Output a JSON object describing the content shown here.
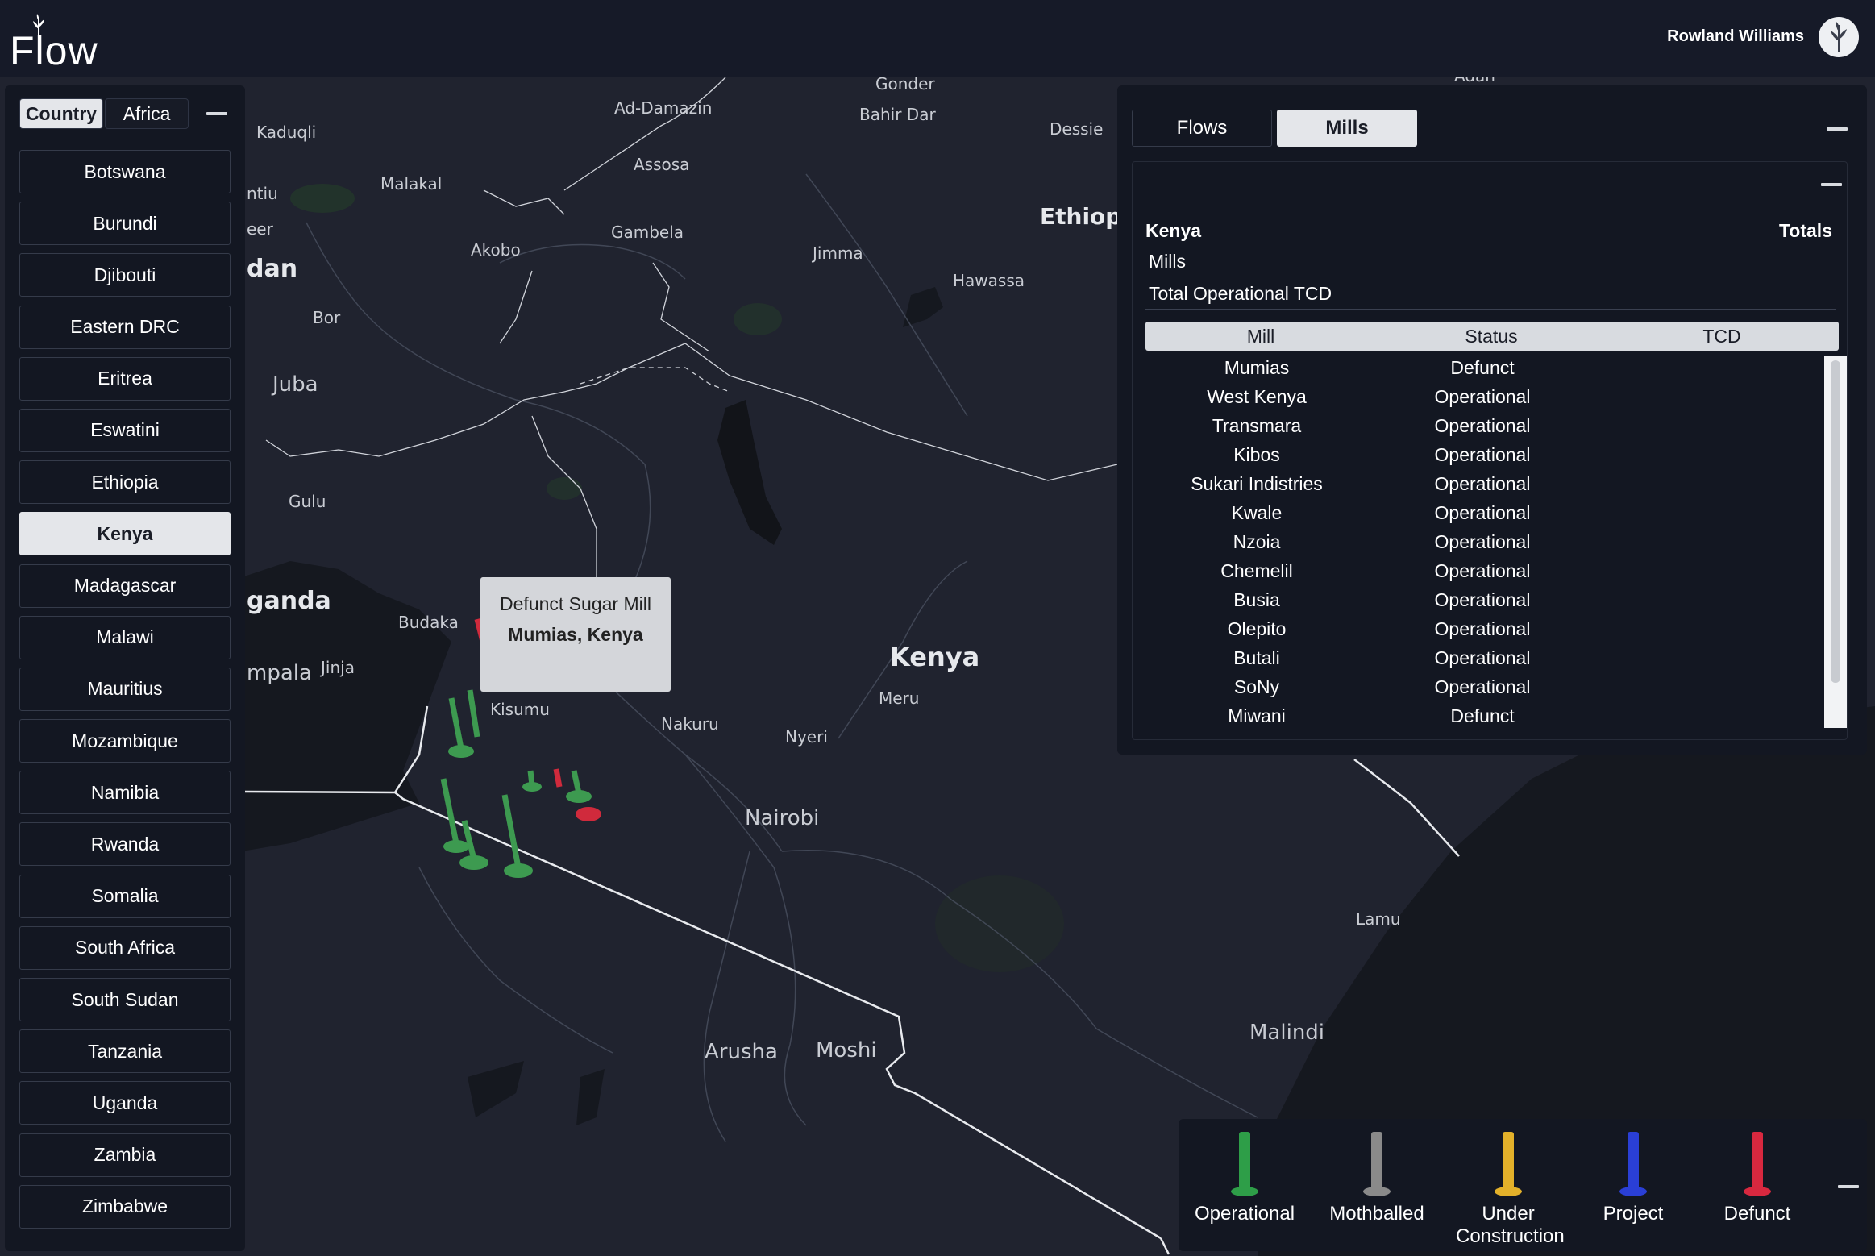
{
  "header": {
    "logo_text": "Flow",
    "user_name": "Rowland Williams"
  },
  "left_panel": {
    "segments": [
      "Country",
      "Africa"
    ],
    "countries": [
      "Botswana",
      "Burundi",
      "Djibouti",
      "Eastern DRC",
      "Eritrea",
      "Eswatini",
      "Ethiopia",
      "Kenya",
      "Madagascar",
      "Malawi",
      "Mauritius",
      "Mozambique",
      "Namibia",
      "Rwanda",
      "Somalia",
      "South Africa",
      "South Sudan",
      "Tanzania",
      "Uganda",
      "Zambia",
      "Zimbabwe"
    ],
    "selected_country": "Kenya"
  },
  "right_panel": {
    "tabs": [
      "Flows",
      "Mills"
    ],
    "active_tab": "Mills",
    "region": "Kenya",
    "totals_label": "Totals",
    "stats": [
      {
        "label": "Mills",
        "value": ""
      },
      {
        "label": "Total Operational TCD",
        "value": ""
      }
    ],
    "table": {
      "columns": [
        "Mill",
        "Status",
        "TCD"
      ],
      "rows": [
        {
          "mill": "Mumias",
          "status": "Defunct",
          "tcd": ""
        },
        {
          "mill": "West Kenya",
          "status": "Operational",
          "tcd": ""
        },
        {
          "mill": "Transmara",
          "status": "Operational",
          "tcd": ""
        },
        {
          "mill": "Kibos",
          "status": "Operational",
          "tcd": ""
        },
        {
          "mill": "Sukari Indistries",
          "status": "Operational",
          "tcd": ""
        },
        {
          "mill": "Kwale",
          "status": "Operational",
          "tcd": ""
        },
        {
          "mill": "Nzoia",
          "status": "Operational",
          "tcd": ""
        },
        {
          "mill": "Chemelil",
          "status": "Operational",
          "tcd": ""
        },
        {
          "mill": "Busia",
          "status": "Operational",
          "tcd": ""
        },
        {
          "mill": "Olepito",
          "status": "Operational",
          "tcd": ""
        },
        {
          "mill": "Butali",
          "status": "Operational",
          "tcd": ""
        },
        {
          "mill": "SoNy",
          "status": "Operational",
          "tcd": ""
        },
        {
          "mill": "Miwani",
          "status": "Defunct",
          "tcd": ""
        }
      ]
    }
  },
  "tooltip": {
    "line1": "Defunct Sugar Mill",
    "line2": "Mumias, Kenya"
  },
  "legend": [
    {
      "label": "Operational",
      "color": "#2e9e48"
    },
    {
      "label": "Mothballed",
      "color": "#8a8a8a"
    },
    {
      "label": "Under Construction",
      "color": "#e3b12a"
    },
    {
      "label": "Project",
      "color": "#2a3fd6"
    },
    {
      "label": "Defunct",
      "color": "#d8283f"
    }
  ],
  "map_labels": [
    {
      "text": "Gonder",
      "size": "s"
    },
    {
      "text": "Bahir Dar",
      "size": "s"
    },
    {
      "text": "Ad-Damazin",
      "size": "s"
    },
    {
      "text": "Dessie",
      "size": "s"
    },
    {
      "text": "Kaduqli",
      "size": "s"
    },
    {
      "text": "Assosa",
      "size": "s"
    },
    {
      "text": "Malakal",
      "size": "s"
    },
    {
      "text": "ntiu",
      "size": "s"
    },
    {
      "text": "Gambela",
      "size": "s"
    },
    {
      "text": "Ethiopi",
      "size": "l"
    },
    {
      "text": "eer",
      "size": "s"
    },
    {
      "text": "Akobo",
      "size": "s"
    },
    {
      "text": "Jimma",
      "size": "s"
    },
    {
      "text": "dan",
      "size": "l"
    },
    {
      "text": "Hawassa",
      "size": "s"
    },
    {
      "text": "Bor",
      "size": "s"
    },
    {
      "text": "Juba",
      "size": "m"
    },
    {
      "text": "Gulu",
      "size": "s"
    },
    {
      "text": "ganda",
      "size": "l"
    },
    {
      "text": "Budaka",
      "size": "s"
    },
    {
      "text": "Kenya",
      "size": "l"
    },
    {
      "text": "mpala",
      "size": "m"
    },
    {
      "text": "Jinja",
      "size": "s"
    },
    {
      "text": "Meru",
      "size": "s"
    },
    {
      "text": "Kisumu",
      "size": "s"
    },
    {
      "text": "Nakuru",
      "size": "s"
    },
    {
      "text": "Nyeri",
      "size": "s"
    },
    {
      "text": "Nairobi",
      "size": "m"
    },
    {
      "text": "Lamu",
      "size": "s"
    },
    {
      "text": "Malindi",
      "size": "m"
    },
    {
      "text": "Arusha",
      "size": "m"
    },
    {
      "text": "Moshi",
      "size": "m"
    },
    {
      "text": "Adan",
      "size": "s"
    }
  ]
}
